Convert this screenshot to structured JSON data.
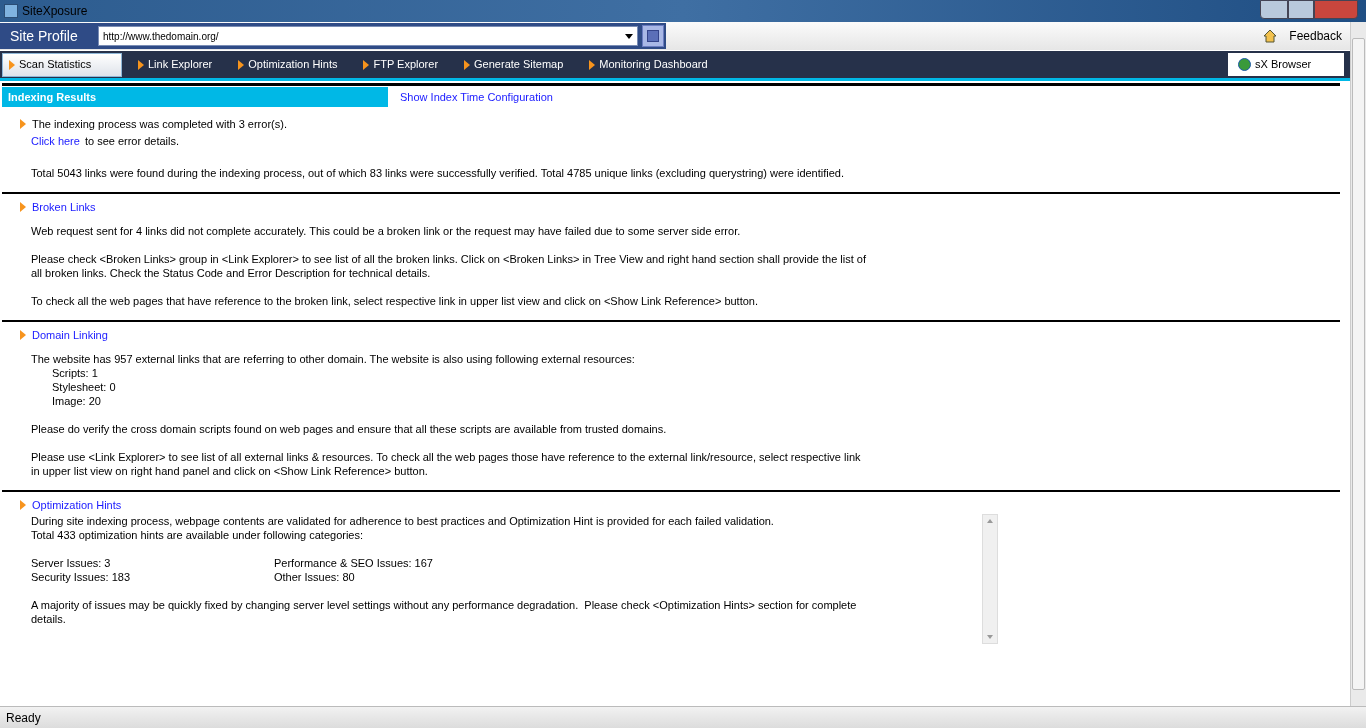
{
  "window": {
    "title": "SiteXposure"
  },
  "profile": {
    "label": "Site Profile",
    "url": "http://www.thedomain.org/"
  },
  "feedback": "Feedback",
  "tabs": [
    {
      "label": "Scan Statistics",
      "selected": true
    },
    {
      "label": "Link Explorer",
      "selected": false
    },
    {
      "label": "Optimization Hints",
      "selected": false
    },
    {
      "label": "FTP Explorer",
      "selected": false
    },
    {
      "label": "Generate Sitemap",
      "selected": false
    },
    {
      "label": "Monitoring Dashboard",
      "selected": false
    }
  ],
  "browser_button": "sX Browser",
  "header": {
    "title": "Indexing Results",
    "link": "Show Index Time Configuration"
  },
  "sections": [
    {
      "kind": "status",
      "title": "The indexing process was completed with 3 error(s).",
      "link": "Click here",
      "link_suffix": "to see error details.",
      "blocks": [
        {
          "kind": "text",
          "lines": [
            "Total 5043 links were found during the indexing process, out of which 83 links were successfully verified. Total 4785 unique links (excluding querystring) were identified."
          ]
        }
      ]
    },
    {
      "kind": "link",
      "title": "Broken Links",
      "blocks": [
        {
          "kind": "text",
          "lines": [
            "Web request sent for 4 links did not complete accurately. This could be a broken link or the request may have failed due to some server side error."
          ]
        },
        {
          "kind": "text",
          "lines": [
            "Please check <Broken Links> group in <Link Explorer> to see list of all the broken links. Click on <Broken Links> in Tree View and right hand section shall provide the list of",
            "all broken links. Check the Status Code and Error Description for technical details."
          ]
        },
        {
          "kind": "text",
          "lines": [
            "To check all the web pages that have reference to the broken link, select respective link in upper list view and click on <Show Link Reference> button."
          ]
        }
      ]
    },
    {
      "kind": "link",
      "title": "Domain Linking",
      "blocks": [
        {
          "kind": "text",
          "lines": [
            "The website has 957 external links that are referring to other domain. The website is also using following external resources:"
          ],
          "items": [
            "Scripts: 1",
            "Stylesheet: 0",
            "Image: 20"
          ]
        },
        {
          "kind": "text",
          "lines": [
            "Please do verify the cross domain scripts found on web pages and ensure that all these scripts are available from trusted domains."
          ]
        },
        {
          "kind": "text",
          "lines": [
            "Please use <Link Explorer> to see list of all external links & resources. To check all the web pages those have reference to the external link/resource, select respective link",
            "in upper list view on right hand panel and click on <Show Link Reference> button."
          ]
        }
      ]
    },
    {
      "kind": "scroll",
      "title": "Optimization Hints",
      "blocks": [
        {
          "kind": "text",
          "lines": [
            "During site indexing process, webpage contents are validated for adherence to best practices and Optimization Hint is provided for each failed validation.",
            "Total 433 optimization hints are available under following categories:"
          ]
        },
        {
          "kind": "grid",
          "cells": [
            "Server Issues: 3",
            "Performance & SEO Issues: 167",
            "Security Issues: 183",
            "Other Issues: 80"
          ]
        },
        {
          "kind": "text",
          "lines": [
            "A majority of issues may be quickly fixed by changing server level settings without any performance degradation.  Please check <Optimization Hints> section for complete",
            "details."
          ]
        }
      ]
    }
  ],
  "status_bar": "Ready"
}
